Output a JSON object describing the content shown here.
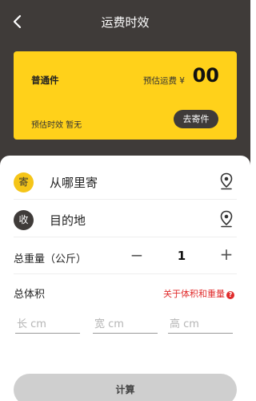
{
  "header": {
    "title": "运费时效",
    "back_icon": "chevron-left-icon"
  },
  "card": {
    "type_label": "普通件",
    "fee_label": "预估运费 ¥",
    "fee_value": "00",
    "eta_label": "预估时效 暂无",
    "send_button": "去寄件",
    "bg_color": "#ffd11a"
  },
  "form": {
    "sender": {
      "badge": "寄",
      "placeholder": "从哪里寄",
      "icon": "location-pin-icon"
    },
    "receiver": {
      "badge": "收",
      "placeholder": "目的地",
      "icon": "location-pin-icon"
    },
    "weight": {
      "label": "总重量（公斤）",
      "minus": "−",
      "value": "1",
      "plus": "+"
    },
    "volume": {
      "label": "总体积",
      "help_link": "关于体积和重量",
      "help_icon": "question-circle-icon",
      "length_placeholder": "长 cm",
      "width_placeholder": "宽 cm",
      "height_placeholder": "高 cm"
    },
    "calculate_button": "计算"
  },
  "colors": {
    "dark": "#3f3b39",
    "accent": "#ffd11a",
    "link": "#e02b2b"
  }
}
